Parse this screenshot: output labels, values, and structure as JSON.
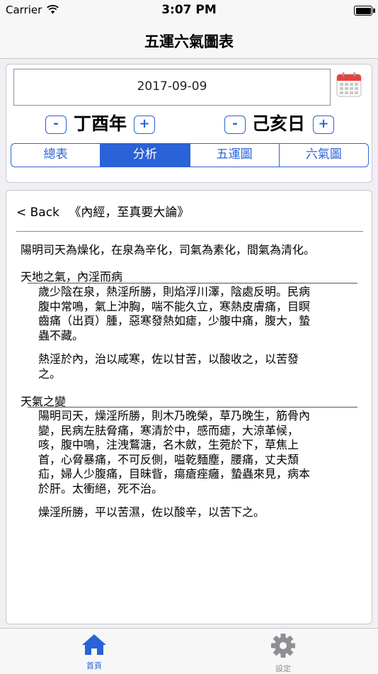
{
  "status_bar": {
    "carrier": "Carrier",
    "time": "3:07 PM"
  },
  "nav": {
    "title": "五運六氣圖表"
  },
  "date_picker": {
    "value": "2017-09-09"
  },
  "year_stepper": {
    "minus": "-",
    "label": "丁酉年",
    "plus": "+"
  },
  "day_stepper": {
    "minus": "-",
    "label": "己亥日",
    "plus": "+"
  },
  "segments": [
    {
      "label": "總表",
      "selected": false
    },
    {
      "label": "分析",
      "selected": true
    },
    {
      "label": "五運圖",
      "selected": false
    },
    {
      "label": "六氣圖",
      "selected": false
    }
  ],
  "content": {
    "back_label": "< Back",
    "source": "《內經，至真要大論》",
    "intro": "陽明司天為燥化，在泉為辛化，司氣為素化，間氣為清化。",
    "sections": [
      {
        "title": "天地之氣，內淫而病",
        "paragraphs": [
          [
            "歲少陰在泉，熱淫所勝，則焰浮川澤，陰處反明。民病",
            "腹中常鳴，氣上沖胸，喘不能久立，寒熱皮膚痛，目瞑",
            "齒痛（出頁）腫，惡寒發熱如瘧，少腹中痛，腹大，蟄",
            "蟲不藏。"
          ],
          [
            "熱淫於內，治以咸寒，佐以甘苦，以酸收之，以苦發",
            "之。"
          ]
        ]
      },
      {
        "title": "天氣之變",
        "paragraphs": [
          [
            "陽明司天，燥淫所勝，則木乃晚榮，草乃晚生，筋骨內",
            "變，民病左胠脅痛，寒清於中，感而瘧，大涼革候，",
            "咳，腹中鳴，注洩鶩溏，名木斂，生菀於下，草焦上",
            "首，心脅暴痛，不可反側，嗌乾麵塵，腰痛，丈夫頹",
            "疝，婦人少腹痛，目昧眥，瘍瘡痤癰，蟄蟲來見，病本",
            "於肝。太衝絕，死不治。"
          ],
          [
            "燥淫所勝，平以苦濕，佐以酸辛，以苦下之。"
          ]
        ]
      }
    ]
  },
  "tab_bar": {
    "items": [
      {
        "label": "首頁",
        "icon": "home-icon",
        "selected": true
      },
      {
        "label": "設定",
        "icon": "gear-icon",
        "selected": false
      }
    ]
  },
  "colors": {
    "accent": "#2a62d8",
    "inactive": "#8e8e93",
    "calendar_red": "#e8433b"
  }
}
